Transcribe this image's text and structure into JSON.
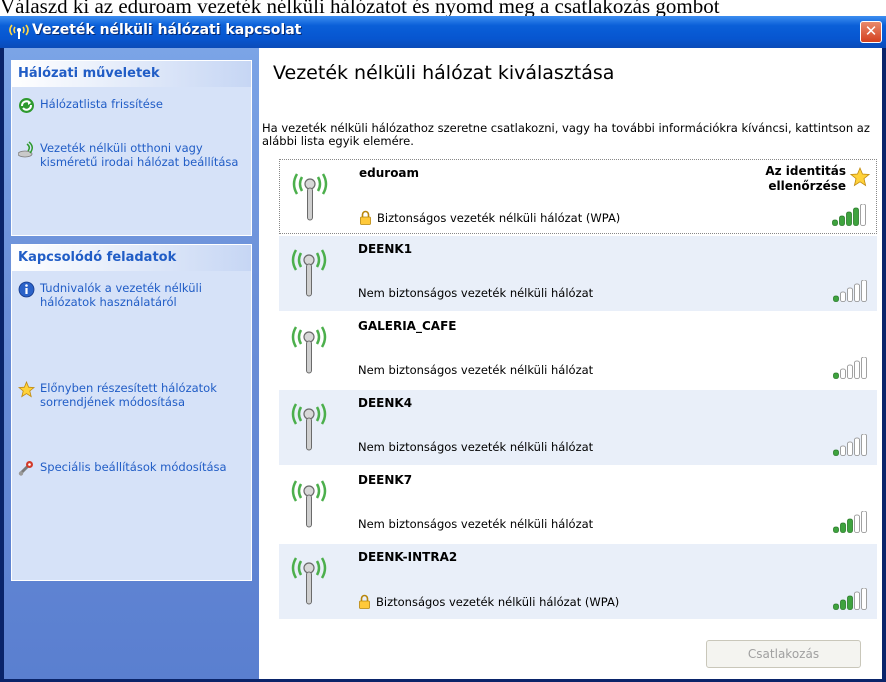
{
  "document_line": "Válaszd ki az eduroam vezeték nélküli hálózatot és nyomd meg a csatlakozás gombot",
  "window": {
    "title": "Vezeték nélküli hálózati kapcsolat",
    "close_glyph": "✕"
  },
  "sidebar": {
    "network_tasks": {
      "header": "Hálózati műveletek",
      "items": [
        {
          "label": "Hálózatlista frissítése",
          "icon": "refresh-icon"
        },
        {
          "label": "Vezeték nélküli otthoni vagy kisméretű irodai hálózat beállítása",
          "icon": "wireless-setup-icon"
        }
      ]
    },
    "related_tasks": {
      "header": "Kapcsolódó feladatok",
      "items": [
        {
          "label": "Tudnivalók a vezeték nélküli hálózatok használatáról",
          "icon": "info-icon"
        },
        {
          "label": "Előnyben részesített hálózatok sorrendjének módosítása",
          "icon": "star-icon"
        },
        {
          "label": "Speciális beállítások módosítása",
          "icon": "settings-icon"
        }
      ]
    }
  },
  "main": {
    "title": "Vezeték nélküli hálózat kiválasztása",
    "description": "Ha vezeték nélküli hálózathoz szeretne csatlakozni, vagy ha további információkra kíváncsi, kattintson az alábbi lista egyik elemére.",
    "networks": [
      {
        "name": "eduroam",
        "status": "Biztonságos vezeték nélküli hálózat (WPA)",
        "secured": true,
        "signal": 4,
        "auth_label": "Az identitás ellenőrzése",
        "selected": true
      },
      {
        "name": "DEENK1",
        "status": "Nem biztonságos vezeték nélküli hálózat",
        "secured": false,
        "signal": 1
      },
      {
        "name": "GALERIA_CAFE",
        "status": "Nem biztonságos vezeték nélküli hálózat",
        "secured": false,
        "signal": 1
      },
      {
        "name": "DEENK4",
        "status": "Nem biztonságos vezeték nélküli hálózat",
        "secured": false,
        "signal": 1
      },
      {
        "name": "DEENK7",
        "status": "Nem biztonságos vezeték nélküli hálózat",
        "secured": false,
        "signal": 3
      },
      {
        "name": "DEENK-INTRA2",
        "status": "Biztonságos vezeték nélküli hálózat (WPA)",
        "secured": true,
        "signal": 3
      }
    ],
    "connect_button": "Csatlakozás"
  },
  "colors": {
    "signal_on": "#3ea33e",
    "signal_off": "#ffffff",
    "link": "#215dc6"
  }
}
